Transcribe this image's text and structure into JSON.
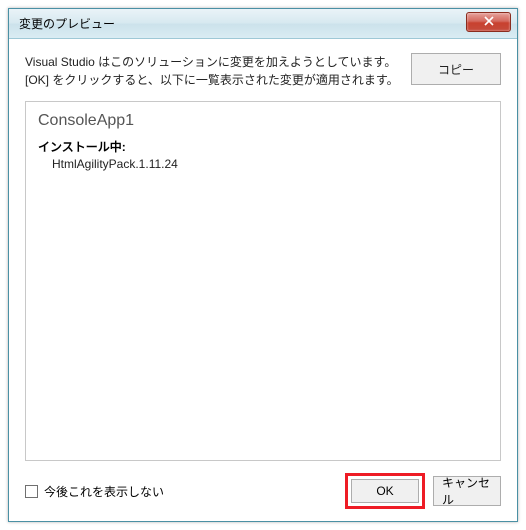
{
  "window": {
    "title": "変更のプレビュー"
  },
  "description": "Visual Studio はこのソリューションに変更を加えようとしています。[OK] をクリックすると、以下に一覧表示された変更が適用されます。",
  "buttons": {
    "copy": "コピー",
    "ok": "OK",
    "cancel": "キャンセル"
  },
  "content": {
    "project_name": "ConsoleApp1",
    "install_label": "インストール中:",
    "packages": [
      "HtmlAgilityPack.1.11.24"
    ]
  },
  "checkbox": {
    "label": "今後これを表示しない"
  },
  "icons": {
    "close": "close"
  }
}
